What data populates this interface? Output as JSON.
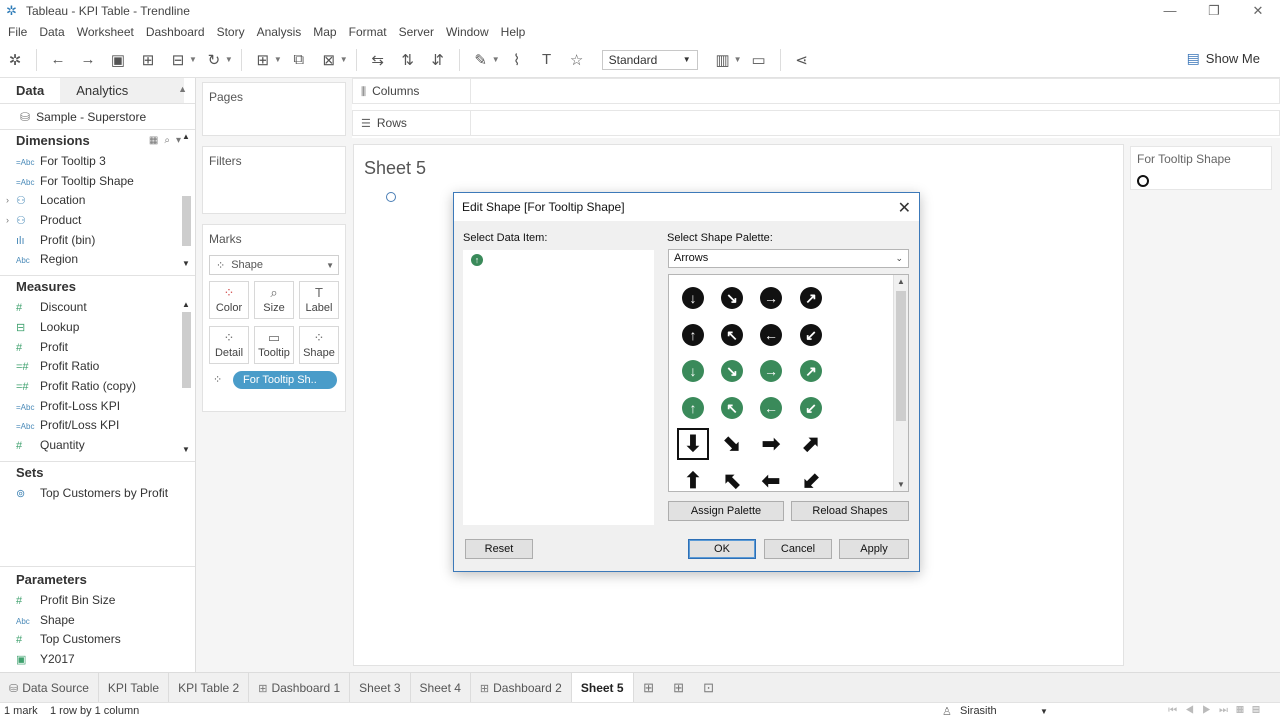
{
  "window": {
    "title": "Tableau - KPI Table - Trendline",
    "controls": [
      "—",
      "❐",
      "✕"
    ]
  },
  "menu": [
    "File",
    "Data",
    "Worksheet",
    "Dashboard",
    "Story",
    "Analysis",
    "Map",
    "Format",
    "Server",
    "Window",
    "Help"
  ],
  "toolbar": {
    "fit_value": "Standard",
    "show_me_label": "Show Me"
  },
  "data_pane": {
    "tabs": [
      "Data",
      "Analytics"
    ],
    "datasource": "Sample - Superstore",
    "dimensions_header": "Dimensions",
    "dimensions": [
      {
        "label": "For Tooltip 3",
        "type": "=Abc"
      },
      {
        "label": "For Tooltip Shape",
        "type": "=Abc"
      },
      {
        "label": "Location",
        "type": "hier"
      },
      {
        "label": "Product",
        "type": "hier"
      },
      {
        "label": "Profit (bin)",
        "type": "bin"
      },
      {
        "label": "Region",
        "type": "Abc"
      }
    ],
    "measures_header": "Measures",
    "measures": [
      {
        "label": "Discount",
        "type": "#"
      },
      {
        "label": "Lookup",
        "type": "=#"
      },
      {
        "label": "Profit",
        "type": "#"
      },
      {
        "label": "Profit Ratio",
        "type": "=#"
      },
      {
        "label": "Profit Ratio (copy)",
        "type": "=#"
      },
      {
        "label": "Profit-Loss KPI",
        "type": "=Abc"
      },
      {
        "label": "Profit/Loss KPI",
        "type": "=Abc"
      },
      {
        "label": "Quantity",
        "type": "#"
      }
    ],
    "sets_header": "Sets",
    "sets": [
      {
        "label": "Top Customers by Profit"
      }
    ],
    "parameters_header": "Parameters",
    "parameters": [
      {
        "label": "Profit Bin Size",
        "type": "#"
      },
      {
        "label": "Shape",
        "type": "Abc"
      },
      {
        "label": "Top Customers",
        "type": "#"
      },
      {
        "label": "Y2017",
        "type": "date"
      }
    ]
  },
  "shelves": {
    "pages": "Pages",
    "filters": "Filters",
    "marks": "Marks",
    "mark_type": "Shape",
    "mark_buttons": [
      "Color",
      "Size",
      "Label",
      "Detail",
      "Tooltip",
      "Shape"
    ],
    "pill": "For Tooltip Sh..",
    "columns": "Columns",
    "rows": "Rows"
  },
  "sheet": {
    "title": "Sheet 5"
  },
  "legend": {
    "title": "For Tooltip Shape"
  },
  "dialog": {
    "title": "Edit Shape [For Tooltip Shape]",
    "data_item_label": "Select Data Item:",
    "palette_label": "Select Shape Palette:",
    "palette_value": "Arrows",
    "assign_palette": "Assign Palette",
    "reload_shapes": "Reload Shapes",
    "reset": "Reset",
    "ok": "OK",
    "cancel": "Cancel",
    "apply": "Apply",
    "colors": {
      "black": "#111111",
      "green": "#3a8a5a"
    }
  },
  "sheet_tabs": [
    "KPI Table",
    "KPI Table 2",
    "Dashboard 1",
    "Sheet 3",
    "Sheet 4",
    "Dashboard 2",
    "Sheet 5"
  ],
  "data_source_tab": "Data Source",
  "status": {
    "marks": "1 mark",
    "dims": "1 row by 1 column",
    "user": "Sirasith"
  }
}
